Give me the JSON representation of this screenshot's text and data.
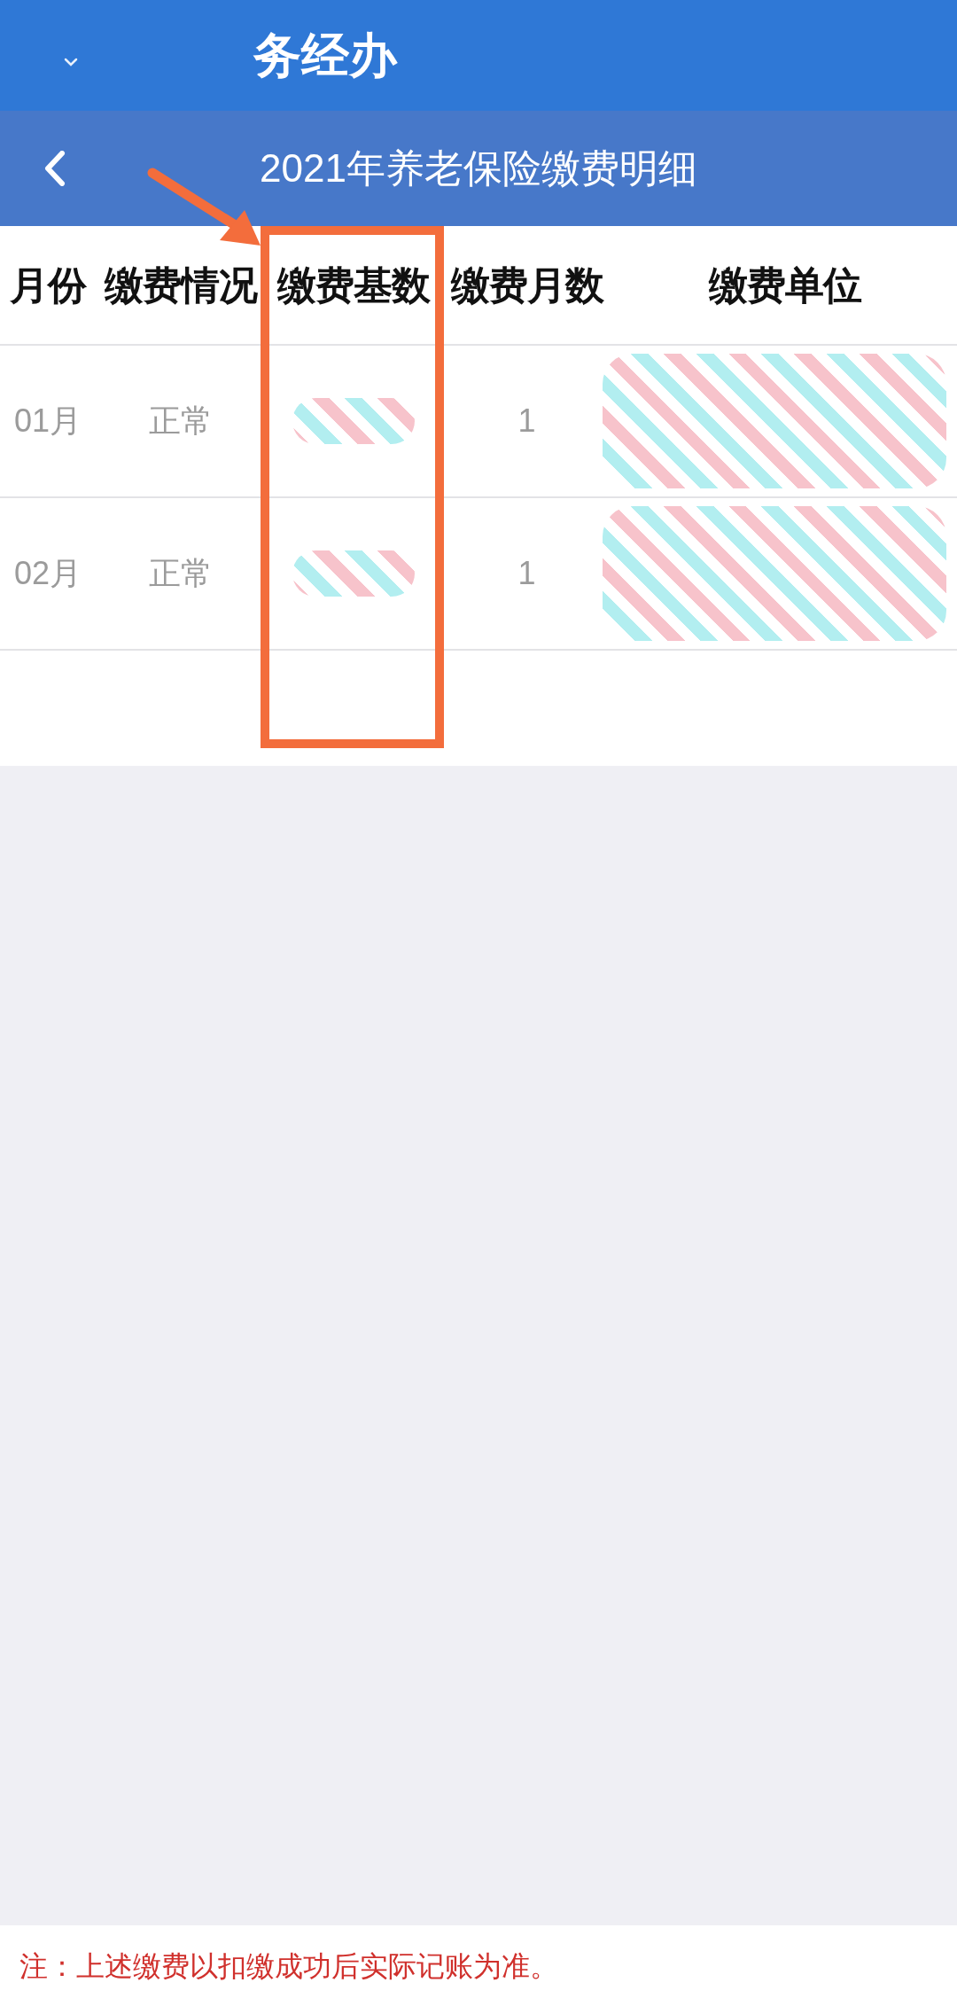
{
  "app_bar": {
    "title": "务经办"
  },
  "nav_bar": {
    "title": "2021年养老保险缴费明细"
  },
  "table": {
    "columns": [
      {
        "label": "月份",
        "highlighted": false
      },
      {
        "label": "缴费情况",
        "highlighted": false
      },
      {
        "label": "缴费基数",
        "highlighted": true
      },
      {
        "label": "缴费月数",
        "highlighted": false
      },
      {
        "label": "缴费单位",
        "highlighted": false
      }
    ],
    "rows": [
      {
        "cells": [
          {
            "text": "01月",
            "redacted": false
          },
          {
            "text": "正常",
            "redacted": false
          },
          {
            "redacted": true
          },
          {
            "text": "1",
            "redacted": false
          },
          {
            "redacted": true
          }
        ]
      },
      {
        "cells": [
          {
            "text": "02月",
            "redacted": false
          },
          {
            "text": "正常",
            "redacted": false
          },
          {
            "redacted": true
          },
          {
            "text": "1",
            "redacted": false
          },
          {
            "redacted": true
          }
        ]
      }
    ]
  },
  "note": "注：上述缴费以扣缴成功后实际记账为准。"
}
